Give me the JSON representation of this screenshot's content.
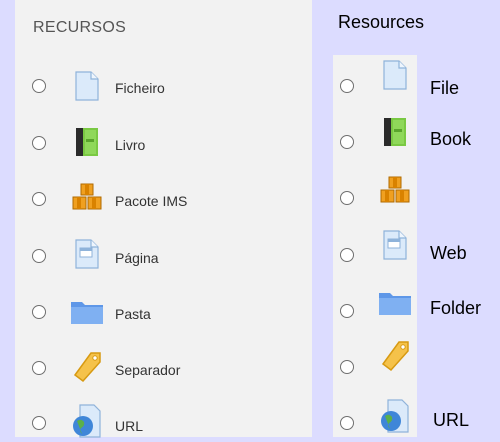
{
  "left": {
    "heading": "RECURSOS",
    "items": [
      {
        "label": "Ficheiro",
        "icon": "file-icon"
      },
      {
        "label": "Livro",
        "icon": "book-icon"
      },
      {
        "label": "Pacote IMS",
        "icon": "ims-package-icon"
      },
      {
        "label": "Página",
        "icon": "page-icon"
      },
      {
        "label": "Pasta",
        "icon": "folder-icon"
      },
      {
        "label": "Separador",
        "icon": "label-tag-icon"
      },
      {
        "label": "URL",
        "icon": "url-icon"
      }
    ]
  },
  "right": {
    "heading": "Resources",
    "items": [
      {
        "label": "File"
      },
      {
        "label": "Book"
      },
      {
        "label": ""
      },
      {
        "label": "Web"
      },
      {
        "label": "Folder"
      },
      {
        "label": ""
      },
      {
        "label": "URL"
      }
    ]
  },
  "colors": {
    "background": "#dcdcff",
    "panel": "#f2f2f2",
    "radio_border": "#6f6f6f"
  }
}
